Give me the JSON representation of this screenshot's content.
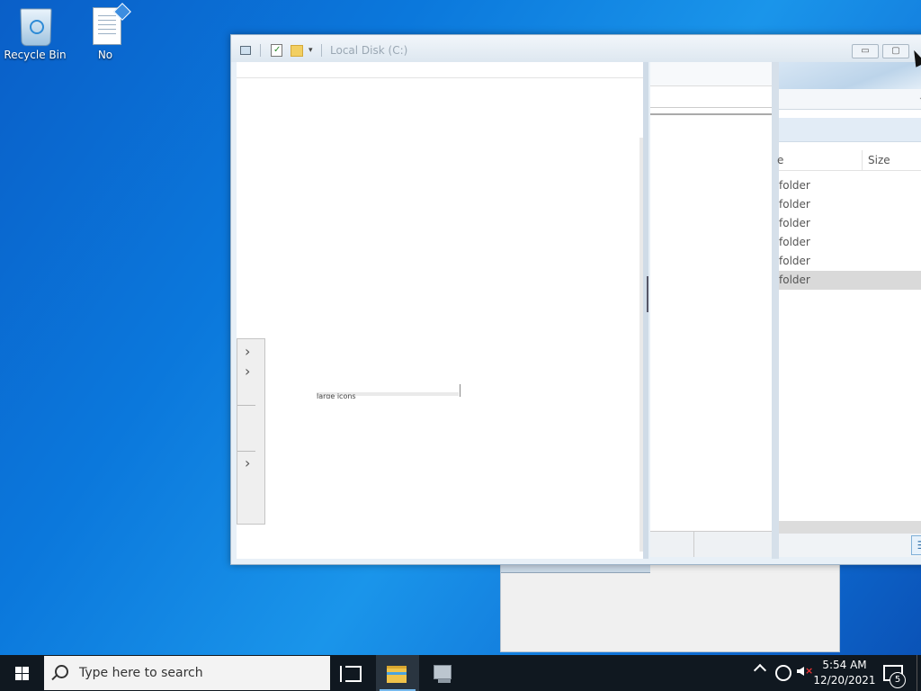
{
  "desktop": {
    "icons": [
      {
        "label": "Recycle Bin",
        "icon": "recycle-bin-icon"
      },
      {
        "label": "No",
        "icon": "text-document-icon"
      }
    ]
  },
  "explorer": {
    "title": "Local Disk (C:)",
    "window_buttons": {
      "minimize": "▭",
      "restore": "▢"
    },
    "columns": {
      "type_fragment": "e",
      "size": "Size"
    },
    "rows": [
      {
        "type": "folder",
        "selected": false
      },
      {
        "type": "folder",
        "selected": false
      },
      {
        "type": "folder",
        "selected": false
      },
      {
        "type": "folder",
        "selected": false
      },
      {
        "type": "folder",
        "selected": false
      },
      {
        "type": "folder",
        "selected": true
      }
    ],
    "left_pane_fragment": "large icons"
  },
  "taskbar": {
    "search_placeholder": "Type here to search",
    "time": "5:54 AM",
    "date": "12/20/2021",
    "notification_count": "5",
    "apps": [
      {
        "name": "task-view",
        "active": false
      },
      {
        "name": "file-explorer",
        "active": true
      },
      {
        "name": "network-drive-app",
        "active": false
      }
    ]
  },
  "colors": {
    "accent": "#76b9ed",
    "taskbar": "#101820",
    "selected_row": "#d9d9d9"
  }
}
